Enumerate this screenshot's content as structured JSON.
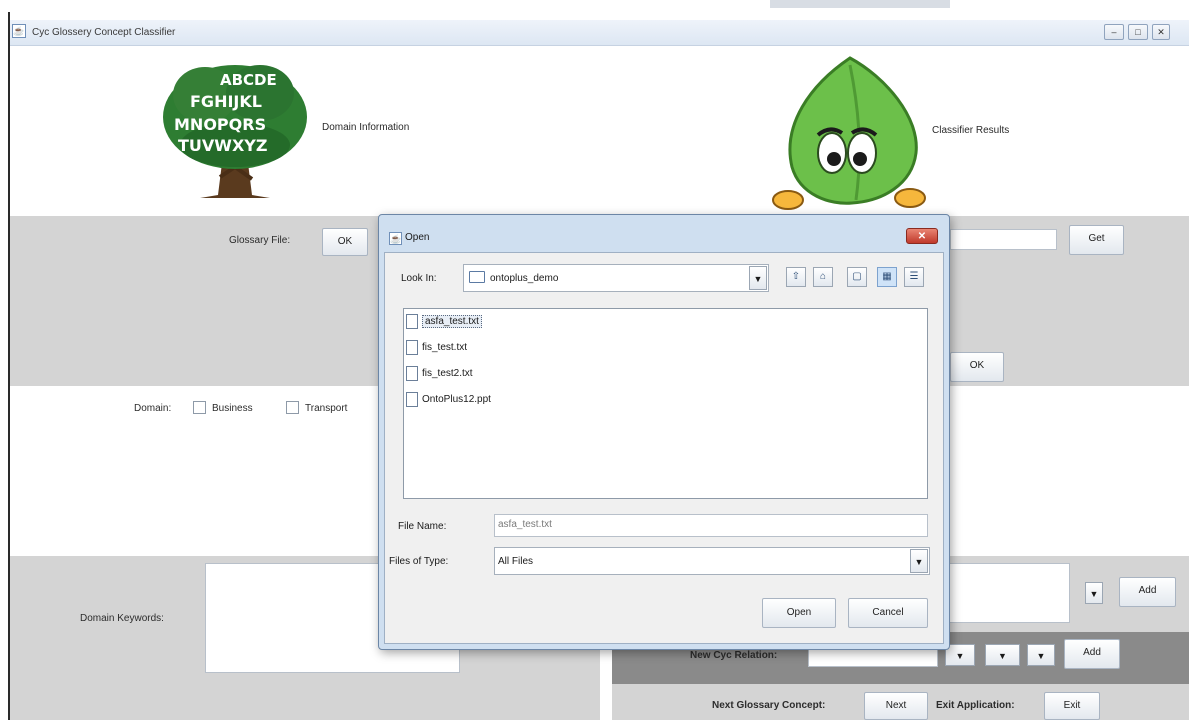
{
  "window": {
    "title": "Cyc Glossery Concept Classifier",
    "controls": [
      "–",
      "□",
      "✕"
    ]
  },
  "header": {
    "domain_info_label": "Domain Information",
    "classifier_results_label": "Classifier Results",
    "tree_letters": [
      "ABCDE",
      "FGHIJKL",
      "MNOPQRS",
      "TUVWXYZ"
    ]
  },
  "glossary": {
    "label": "Glossary File:",
    "ok_label": "OK",
    "get_label": "Get",
    "ok2_label": "OK"
  },
  "domain": {
    "label": "Domain:",
    "options": [
      "Business",
      "Transport"
    ]
  },
  "keywords": {
    "label": "Domain Keywords:",
    "add_label": "Add"
  },
  "cyc_relation": {
    "label": "New Cyc Relation:",
    "add_label": "Add"
  },
  "footer": {
    "next_label": "Next Glossary Concept:",
    "next_button": "Next",
    "exit_label": "Exit Application:",
    "exit_button": "Exit"
  },
  "dialog": {
    "title": "Open",
    "look_in_label": "Look In:",
    "look_in_value": "ontoplus_demo",
    "files": [
      "asfa_test.txt",
      "fis_test.txt",
      "fis_test2.txt",
      "OntoPlus12.ppt"
    ],
    "selected_file": "asfa_test.txt",
    "file_name_label": "File Name:",
    "file_name_value": "asfa_test.txt",
    "files_of_type_label": "Files of Type:",
    "files_of_type_value": "All Files",
    "open_label": "Open",
    "cancel_label": "Cancel"
  },
  "colors": {
    "panel_gray": "#d4d4d4",
    "panel_dark": "#8a8a8a",
    "dialog_frame": "#cfdff0",
    "close_red": "#c0392b",
    "leaf_green": "#6cc04a",
    "tree_green": "#2e7d32"
  }
}
